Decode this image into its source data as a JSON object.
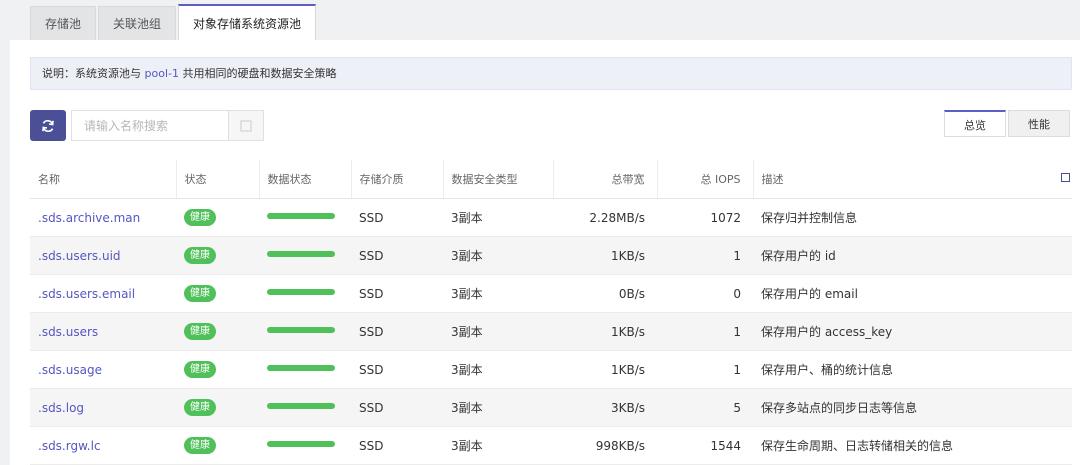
{
  "tabs": [
    "存储池",
    "关联池组",
    "对象存储系统资源池"
  ],
  "notice": {
    "prefix": "说明：系统资源池与 ",
    "link": "pool-1",
    "suffix": " 共用相同的硬盘和数据安全策略"
  },
  "search": {
    "placeholder": "请输入名称搜索"
  },
  "view_tabs": [
    "总览",
    "性能"
  ],
  "table": {
    "headers": [
      "名称",
      "状态",
      "数据状态",
      "存储介质",
      "数据安全类型",
      "总带宽",
      "总 IOPS",
      "描述"
    ],
    "rows": [
      {
        "name": ".sds.archive.man",
        "status": "健康",
        "data_state": 1.0,
        "media": "SSD",
        "safety": "3副本",
        "bandwidth": "2.28MB/s",
        "iops": "1072",
        "desc": "保存归并控制信息"
      },
      {
        "name": ".sds.users.uid",
        "status": "健康",
        "data_state": 1.0,
        "media": "SSD",
        "safety": "3副本",
        "bandwidth": "1KB/s",
        "iops": "1",
        "desc": "保存用户的 id"
      },
      {
        "name": ".sds.users.email",
        "status": "健康",
        "data_state": 1.0,
        "media": "SSD",
        "safety": "3副本",
        "bandwidth": "0B/s",
        "iops": "0",
        "desc": "保存用户的 email"
      },
      {
        "name": ".sds.users",
        "status": "健康",
        "data_state": 1.0,
        "media": "SSD",
        "safety": "3副本",
        "bandwidth": "1KB/s",
        "iops": "1",
        "desc": "保存用户的 access_key"
      },
      {
        "name": ".sds.usage",
        "status": "健康",
        "data_state": 1.0,
        "media": "SSD",
        "safety": "3副本",
        "bandwidth": "1KB/s",
        "iops": "1",
        "desc": "保存用户、桶的统计信息"
      },
      {
        "name": ".sds.log",
        "status": "健康",
        "data_state": 1.0,
        "media": "SSD",
        "safety": "3副本",
        "bandwidth": "3KB/s",
        "iops": "5",
        "desc": "保存多站点的同步日志等信息"
      },
      {
        "name": ".sds.rgw.lc",
        "status": "健康",
        "data_state": 1.0,
        "media": "SSD",
        "safety": "3副本",
        "bandwidth": "998KB/s",
        "iops": "1544",
        "desc": "保存生命周期、日志转储相关的信息"
      }
    ]
  },
  "icons": {
    "refresh": "refresh-icon",
    "search": "search-icon",
    "column_settings": "column-settings-icon"
  },
  "colors": {
    "accent": "#5a5fc4",
    "button": "#4b5096",
    "link": "#5457c0",
    "healthy": "#4fc05a"
  }
}
